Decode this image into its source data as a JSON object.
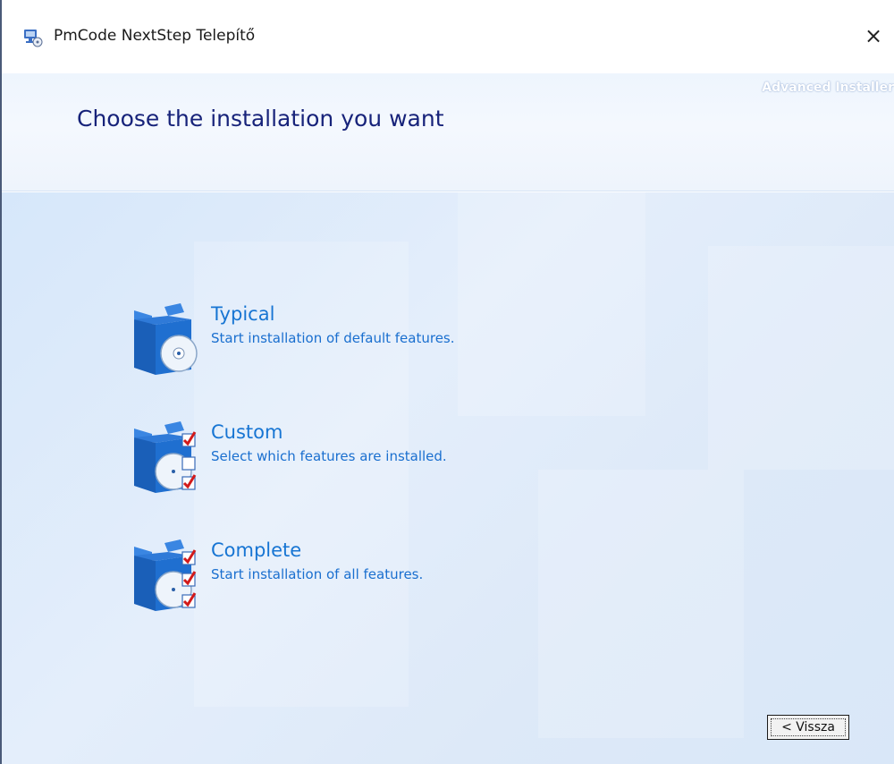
{
  "window": {
    "title": "PmCode NextStep Telepítő",
    "close_glyph": "×"
  },
  "header": {
    "brand": "Advanced Installer",
    "title": "Choose the installation you want"
  },
  "options": [
    {
      "label": "Typical",
      "description": "Start installation of default features.",
      "icon": "box-disc-icon"
    },
    {
      "label": "Custom",
      "description": "Select which features are installed.",
      "icon": "box-disc-checklist-icon"
    },
    {
      "label": "Complete",
      "description": "Start installation of all features.",
      "icon": "box-disc-all-checked-icon"
    }
  ],
  "footer": {
    "back_label": "< Vissza"
  },
  "colors": {
    "title": "#17237a",
    "option_text": "#1775d3",
    "box_blue": "#1f6fd0",
    "check_red": "#d21a1a"
  }
}
